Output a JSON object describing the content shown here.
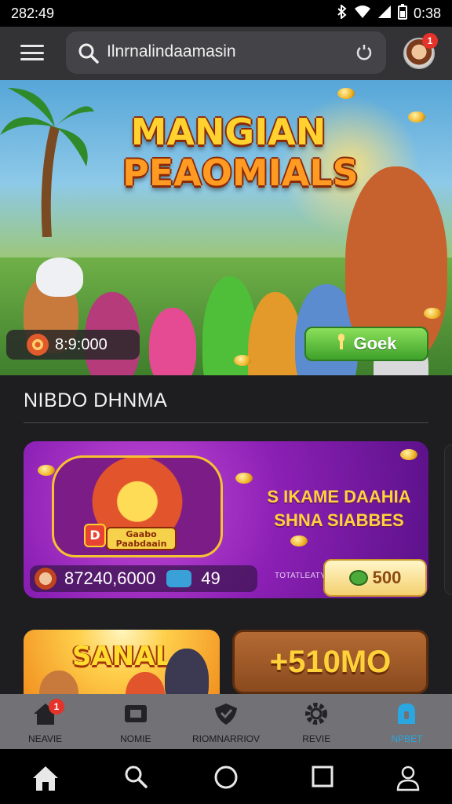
{
  "status_bar": {
    "time": "282:49",
    "clock": "0:38"
  },
  "app_bar": {
    "search_text": "Ilnrnalindaamasin",
    "notification_count": "1"
  },
  "hero": {
    "title_line1": "MANGIAN",
    "title_line2": "PEAOMIALS",
    "coins": "8:9:000",
    "button_label": "Goek"
  },
  "section": {
    "title": "NIBDO DHNMA"
  },
  "promo": {
    "emblem_plaque": "Gaabo Paabdaain",
    "emblem_dollar": "D",
    "headline_line1": "S IKAME DAAHIA",
    "headline_line2": "SHNA SIABBES",
    "stat1": "87240,6000",
    "stat2": "49",
    "tag": "TOTATLEATYT SOANOPERENNG",
    "price": "500"
  },
  "cards": {
    "card_a_title": "SANAL",
    "card_b_title": "+510MO"
  },
  "bottom_nav": {
    "items": [
      {
        "label": "NEAVIE",
        "icon": "home-icon",
        "badge": "1"
      },
      {
        "label": "NOMIE",
        "icon": "gamepad-icon"
      },
      {
        "label": "RIOMNARRIOV",
        "icon": "shield-icon"
      },
      {
        "label": "REVIE",
        "icon": "gear-icon"
      },
      {
        "label": "NPBET",
        "icon": "bag-icon"
      }
    ]
  },
  "colors": {
    "accent": "#2aa7e0",
    "badge": "#e5322a",
    "cta_green": "#3ea12a",
    "promo_purple": "#8c20b5"
  }
}
